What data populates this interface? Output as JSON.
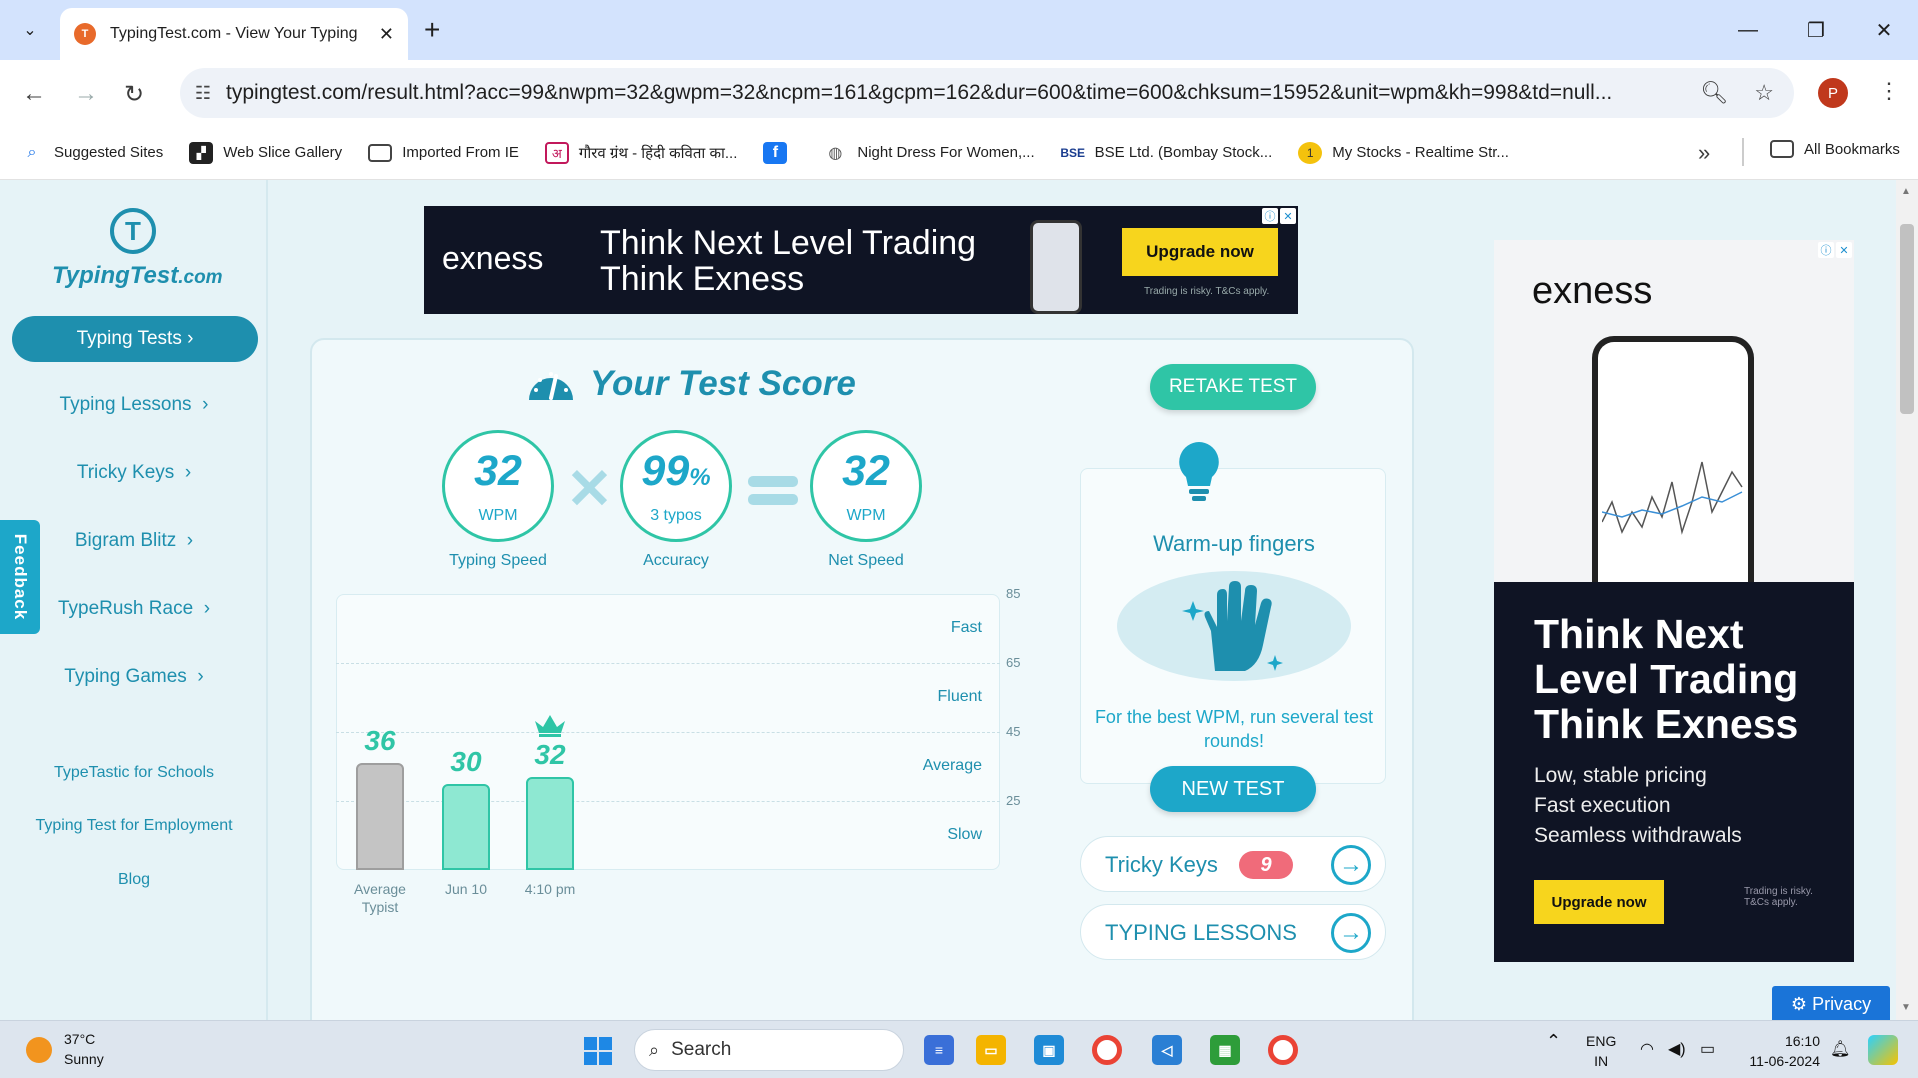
{
  "browser": {
    "tab_title": "TypingTest.com - View Your Typing Te",
    "url": "typingtest.com/result.html?acc=99&nwpm=32&gwpm=32&ncpm=161&gcpm=162&dur=600&time=600&chksum=15952&unit=wpm&kh=998&td=null...",
    "profile_initial": "P",
    "bookmarks": [
      {
        "label": "Suggested Sites",
        "icon": "search-icon"
      },
      {
        "label": "Web Slice Gallery",
        "icon": "web-slice-icon"
      },
      {
        "label": "Imported From IE",
        "icon": "folder-icon"
      },
      {
        "label": "गौरव ग्रंथ - हिंदी कविता का...",
        "icon": "kavita-icon"
      },
      {
        "label": "",
        "icon": "facebook-icon"
      },
      {
        "label": "Night Dress For Women,...",
        "icon": "globe-icon"
      },
      {
        "label": "BSE Ltd. (Bombay Stock...",
        "icon": "bse-icon"
      },
      {
        "label": "My Stocks - Realtime Str...",
        "icon": "stocks-icon"
      }
    ],
    "all_bookmarks": "All Bookmarks"
  },
  "sidebar": {
    "logo_main": "TypingTest",
    "logo_suffix": ".com",
    "primary": "Typing Tests",
    "items": [
      "Typing Lessons",
      "Tricky Keys",
      "Bigram Blitz",
      "TypeRush Race",
      "Typing Games"
    ],
    "links": [
      "TypeTastic for Schools",
      "Typing Test for Employment",
      "Blog"
    ],
    "feedback": "Feedback"
  },
  "ads": {
    "top": {
      "brand": "exness",
      "line1": "Think Next Level Trading",
      "line2": "Think Exness",
      "cta": "Upgrade now",
      "fine": "Trading is risky. T&Cs apply."
    },
    "right": {
      "brand": "exness",
      "headline": "Think Next Level Trading Think Exness",
      "features": [
        "Low, stable pricing",
        "Fast execution",
        "Seamless withdrawals"
      ],
      "cta": "Upgrade now",
      "fine": "Trading is risky. T&Cs apply."
    }
  },
  "result": {
    "title": "Your Test Score",
    "retake": "RETAKE TEST",
    "speed": {
      "value": "32",
      "unit": "WPM",
      "label": "Typing Speed"
    },
    "accuracy": {
      "value": "99",
      "suffix": "%",
      "unit": "3 typos",
      "label": "Accuracy"
    },
    "net": {
      "value": "32",
      "unit": "WPM",
      "label": "Net Speed"
    },
    "warmup": {
      "title": "Warm-up fingers",
      "text": "For the best WPM, run several test rounds!",
      "button": "NEW TEST"
    },
    "pills": [
      {
        "label": "Tricky Keys",
        "badge": "9"
      },
      {
        "label": "TYPING LESSONS",
        "badge": ""
      }
    ]
  },
  "chart_data": {
    "type": "bar",
    "categories": [
      "Average Typist",
      "Jun 10",
      "4:10 pm"
    ],
    "values": [
      36,
      30,
      32
    ],
    "data_labels": [
      "36",
      "30",
      "32"
    ],
    "yticks": [
      "85",
      "65",
      "45",
      "25"
    ],
    "ylim": [
      5,
      85
    ],
    "bands": [
      "Fast",
      "Fluent",
      "Average",
      "Slow"
    ],
    "colors": {
      "average": "#c4c4c4",
      "user": "#8ee8d2",
      "label": "#2fc5a6"
    }
  },
  "privacy": "Privacy",
  "taskbar": {
    "temp": "37°C",
    "condition": "Sunny",
    "search": "Search",
    "lang1": "ENG",
    "lang2": "IN",
    "time": "16:10",
    "date": "11-06-2024"
  }
}
